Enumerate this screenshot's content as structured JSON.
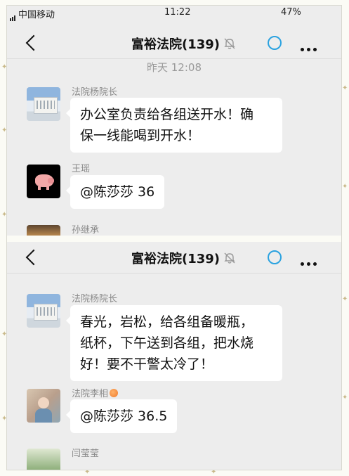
{
  "status_bar": {
    "carrier": "中国移动",
    "time": "11:22",
    "battery": "47%"
  },
  "screens": [
    {
      "header": {
        "title": "富裕法院(139)"
      },
      "timestamp": "昨天 12:08",
      "messages": [
        {
          "sender": "法院杨院长",
          "text_lines": [
            "办公室负责给各组送开水！确",
            "保一线能喝到开水！"
          ]
        },
        {
          "sender": "王瑶",
          "text_lines": [
            "@陈莎莎 36"
          ]
        },
        {
          "sender": "孙继承"
        }
      ]
    },
    {
      "header": {
        "title": "富裕法院(139)"
      },
      "messages": [
        {
          "sender": "法院杨院长",
          "text_lines": [
            "春光，岩松，给各组备暖瓶，",
            "纸杯，下午送到各组，把水烧",
            "好！要不干警太冷了！"
          ]
        },
        {
          "sender": "法院李相",
          "text_lines": [
            "@陈莎莎 36.5"
          ]
        },
        {
          "sender": "闫莹莹"
        }
      ]
    }
  ],
  "colors": {
    "background": "#ededed",
    "bubble": "#ffffff",
    "accent_ring": "#2aa2e0"
  },
  "icons": [
    "back-icon",
    "mute-bell-icon",
    "loading-ring-icon",
    "more-icon",
    "peach-emoji-icon"
  ]
}
